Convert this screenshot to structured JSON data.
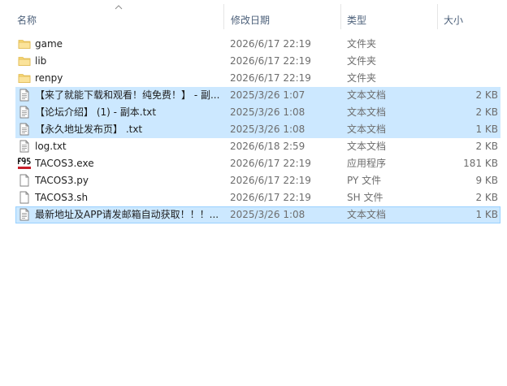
{
  "columns": {
    "name": "名称",
    "date": "修改日期",
    "type": "类型",
    "size": "大小"
  },
  "files": [
    {
      "name": "game",
      "date": "2026/6/17 22:19",
      "type": "文件夹",
      "size": "",
      "icon": "folder-icon",
      "selected": false
    },
    {
      "name": "lib",
      "date": "2026/6/17 22:19",
      "type": "文件夹",
      "size": "",
      "icon": "folder-icon",
      "selected": false
    },
    {
      "name": "renpy",
      "date": "2026/6/17 22:19",
      "type": "文件夹",
      "size": "",
      "icon": "folder-icon",
      "selected": false
    },
    {
      "name": "【来了就能下载和观看！纯免费！】 - 副...",
      "date": "2025/3/26 1:07",
      "type": "文本文档",
      "size": "2 KB",
      "icon": "text-file-icon",
      "selected": true
    },
    {
      "name": "【论坛介绍】 (1) - 副本.txt",
      "date": "2025/3/26 1:08",
      "type": "文本文档",
      "size": "2 KB",
      "icon": "text-file-icon",
      "selected": true
    },
    {
      "name": "【永久地址发布页】 .txt",
      "date": "2025/3/26 1:08",
      "type": "文本文档",
      "size": "1 KB",
      "icon": "text-file-icon",
      "selected": true
    },
    {
      "name": "log.txt",
      "date": "2026/6/18 2:59",
      "type": "文本文档",
      "size": "2 KB",
      "icon": "text-file-icon",
      "selected": false
    },
    {
      "name": "TACOS3.exe",
      "date": "2026/6/17 22:19",
      "type": "应用程序",
      "size": "181 KB",
      "icon": "f95-app-icon",
      "selected": false
    },
    {
      "name": "TACOS3.py",
      "date": "2026/6/17 22:19",
      "type": "PY 文件",
      "size": "9 KB",
      "icon": "blank-file-icon",
      "selected": false
    },
    {
      "name": "TACOS3.sh",
      "date": "2026/6/17 22:19",
      "type": "SH 文件",
      "size": "2 KB",
      "icon": "blank-file-icon",
      "selected": false
    },
    {
      "name": "最新地址及APP请发邮箱自动获取！！！...",
      "date": "2025/3/26 1:08",
      "type": "文本文档",
      "size": "1 KB",
      "icon": "text-file-icon",
      "selected": true
    }
  ],
  "colors": {
    "selection": "#cce8ff",
    "selection_border": "#99d1ff",
    "folder": "#f8d775",
    "header_text": "#4c607a"
  }
}
